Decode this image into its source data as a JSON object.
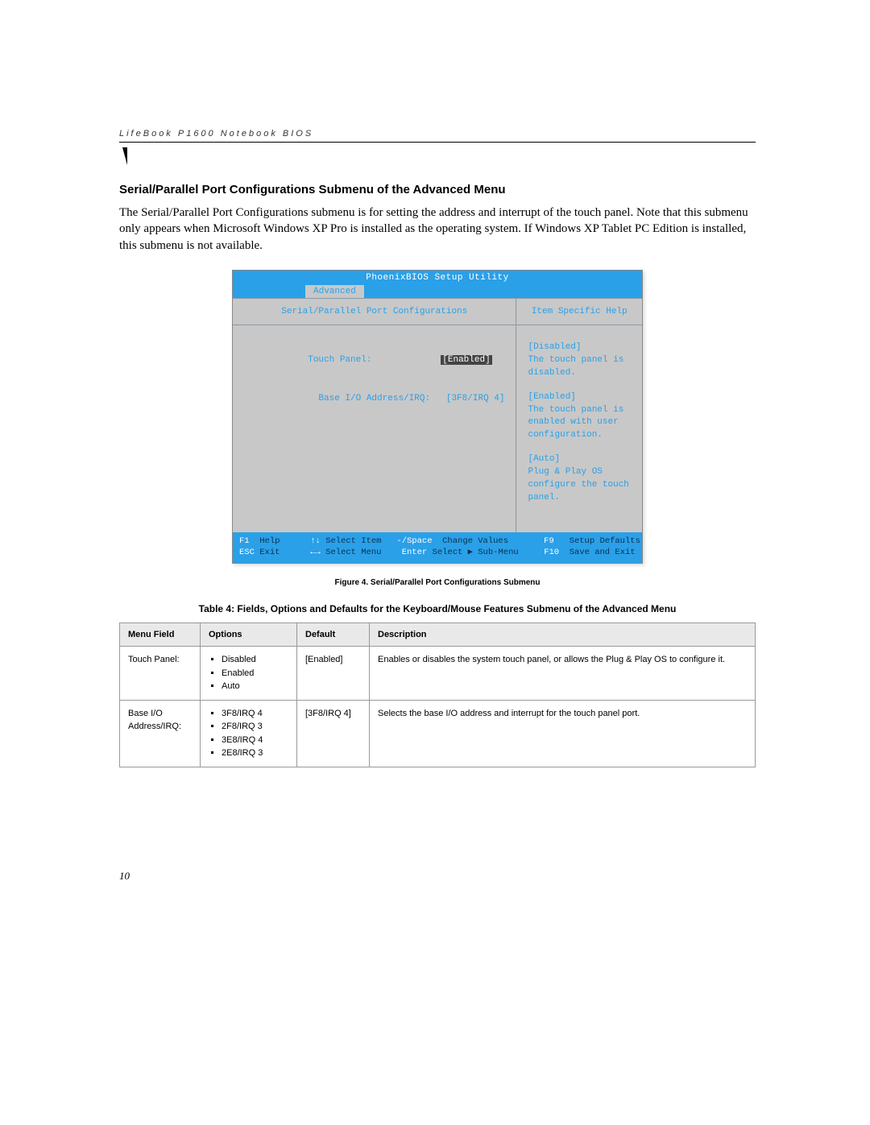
{
  "header": {
    "running": "LifeBook P1600 Notebook BIOS"
  },
  "section": {
    "heading": "Serial/Parallel Port Configurations Submenu of the Advanced Menu",
    "body": "The Serial/Parallel Port Configurations submenu is for setting the address and interrupt of the touch panel.  Note that this submenu only appears when Microsoft Windows XP Pro is installed as the operating system. If Windows XP Tablet PC Edition is installed, this submenu is not available."
  },
  "bios": {
    "title": "PhoenixBIOS Setup Utility",
    "tab_active": "Advanced",
    "left_title": "Serial/Parallel Port Configurations",
    "right_title": "Item Specific Help",
    "field1_label": "Touch Panel:",
    "field1_value": "[Enabled]",
    "field2_label": "Base I/O Address/IRQ:",
    "field2_value": "[3F8/IRQ 4]",
    "help": {
      "b1_head": "[Disabled]",
      "b1_body": "The touch panel is disabled.",
      "b2_head": "[Enabled]",
      "b2_body": "The touch panel is enabled with user configuration.",
      "b3_head": "[Auto]",
      "b3_body": "Plug & Play OS configure the touch panel."
    },
    "footer": {
      "r1_k1": "F1",
      "r1_l1": "Help",
      "r1_k2": "↑↓",
      "r1_l2": "Select Item",
      "r1_k3": "-/Space",
      "r1_l3": "Change Values",
      "r1_k4": "F9",
      "r1_l4": "Setup Defaults",
      "r2_k1": "ESC",
      "r2_l1": "Exit",
      "r2_k2": "←→",
      "r2_l2": "Select Menu",
      "r2_k3": "Enter",
      "r2_l3": "Select ▶ Sub-Menu",
      "r2_k4": "F10",
      "r2_l4": "Save and Exit"
    }
  },
  "figure_caption": "Figure 4.  Serial/Parallel Port Configurations Submenu",
  "table": {
    "title": "Table 4: Fields, Options and Defaults for the Keyboard/Mouse Features Submenu of the Advanced Menu",
    "headers": {
      "c1": "Menu Field",
      "c2": "Options",
      "c3": "Default",
      "c4": "Description"
    },
    "rows": [
      {
        "menu": "Touch Panel:",
        "options": [
          "Disabled",
          "Enabled",
          "Auto"
        ],
        "default": "[Enabled]",
        "description": "Enables or disables the system touch panel, or allows the Plug & Play OS to configure it."
      },
      {
        "menu": "Base I/O Address/IRQ:",
        "options": [
          "3F8/IRQ 4",
          "2F8/IRQ 3",
          "3E8/IRQ 4",
          "2E8/IRQ 3"
        ],
        "default": "[3F8/IRQ 4]",
        "description": "Selects the base I/O address and interrupt for the touch panel port."
      }
    ]
  },
  "page_number": "10"
}
